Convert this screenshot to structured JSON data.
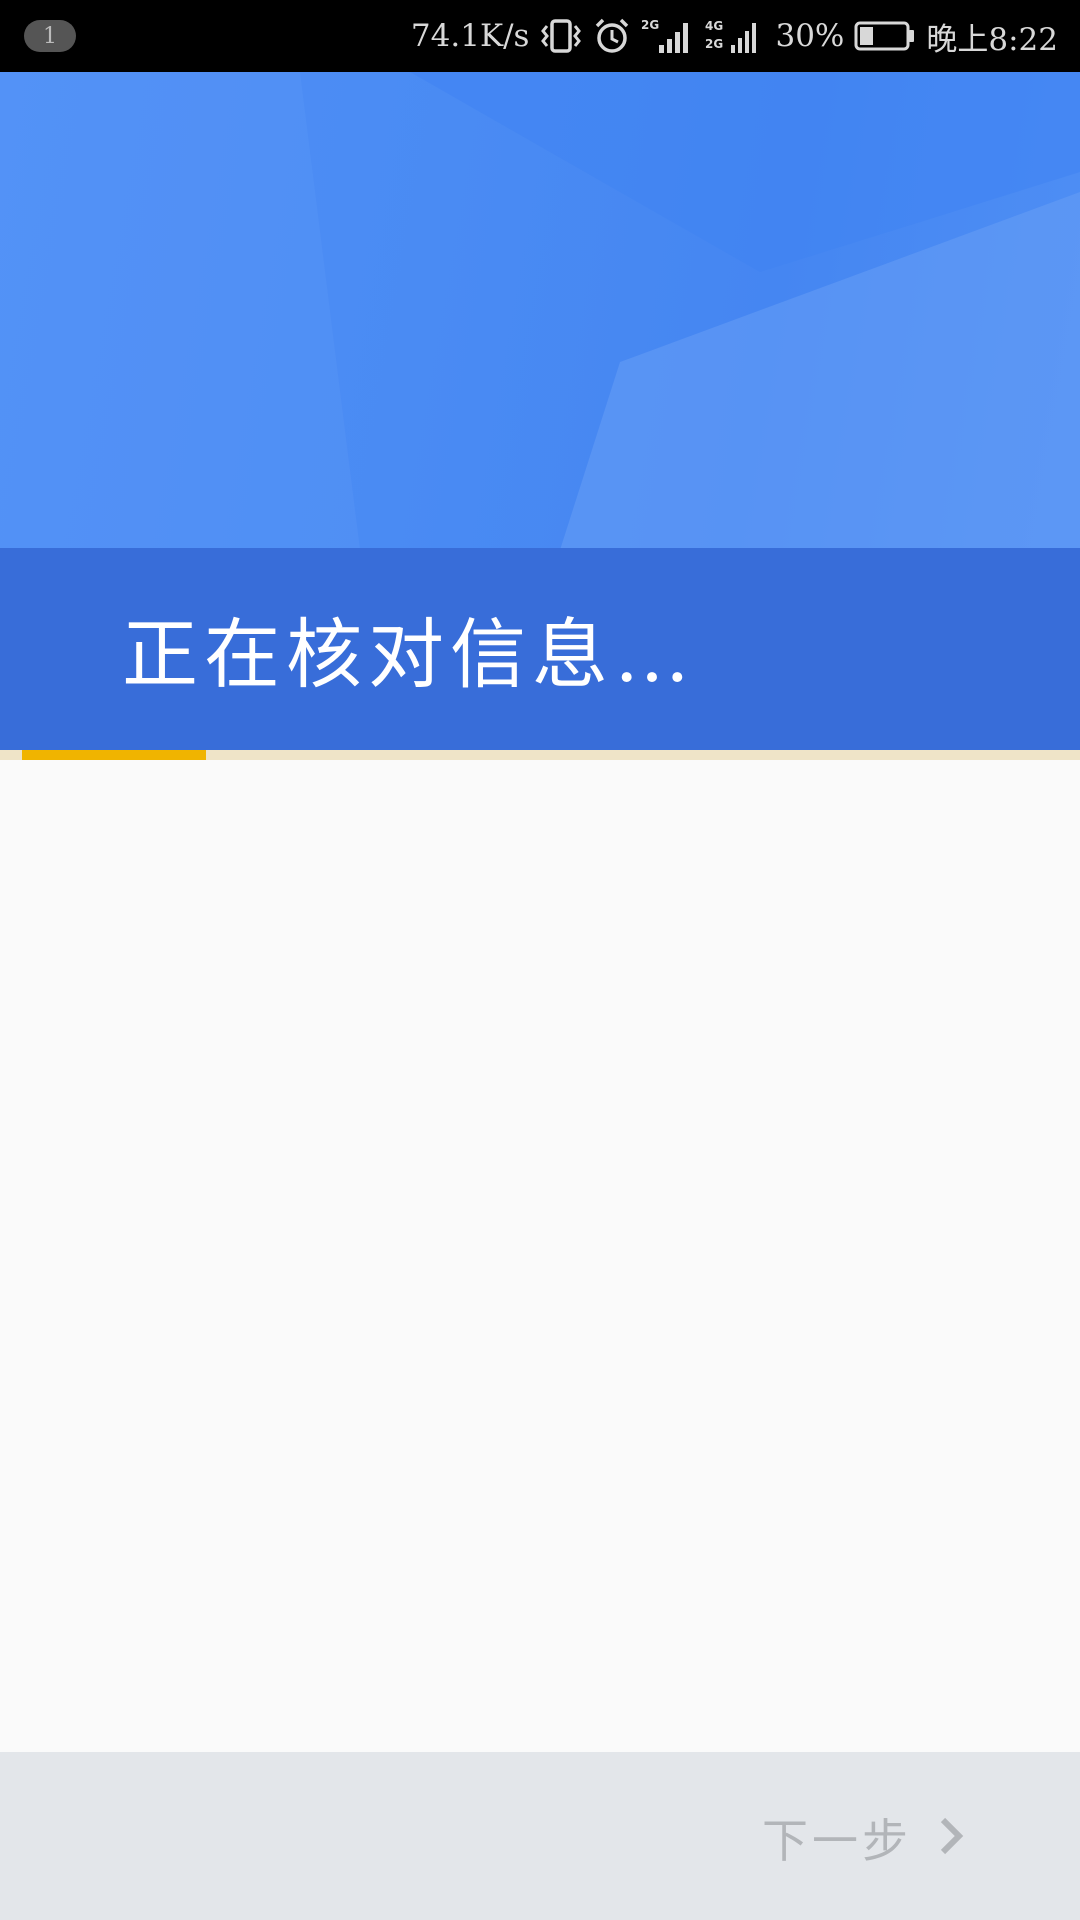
{
  "status_bar": {
    "notification_count": "1",
    "net_speed": "74.1K/s",
    "icons": [
      "vibrate-icon",
      "alarm-icon",
      "signal-2g-icon",
      "signal-4g-2g-icon",
      "battery-icon"
    ],
    "signal_2g_label": "2G",
    "signal_4g_label": "4G",
    "signal_2g_label_b": "2G",
    "battery_percent": "30%",
    "battery_level": 0.3,
    "time": "晚上8:22"
  },
  "header": {
    "title": "正在核对信息…",
    "colors": {
      "light_blue": "#4a8bf3",
      "band_blue": "#386dd9"
    }
  },
  "progress": {
    "value": 0.17,
    "color": "#f0b400"
  },
  "bottom_bar": {
    "next_label": "下一步",
    "next_icon": "chevron-right-icon"
  }
}
